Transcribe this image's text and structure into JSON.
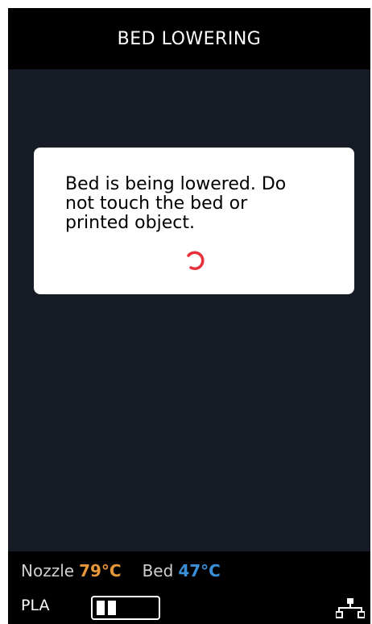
{
  "header": {
    "title": "BED LOWERING"
  },
  "dialog": {
    "message": "Bed is being lowered. Do\nnot touch the bed or\nprinted object.",
    "spinner_icon": "loading-spinner-icon",
    "spinner_color": "#e8303a"
  },
  "status": {
    "nozzle_label": "Nozzle",
    "nozzle_temp": "79°C",
    "bed_label": "Bed",
    "bed_temp": "47°C",
    "material": "PLA",
    "filament_icon": "filament-level-icon",
    "network_icon": "network-icon"
  },
  "colors": {
    "background": "#161b25",
    "bars": "#000000",
    "nozzle_accent": "#e8963a",
    "bed_accent": "#3b8fd9"
  }
}
